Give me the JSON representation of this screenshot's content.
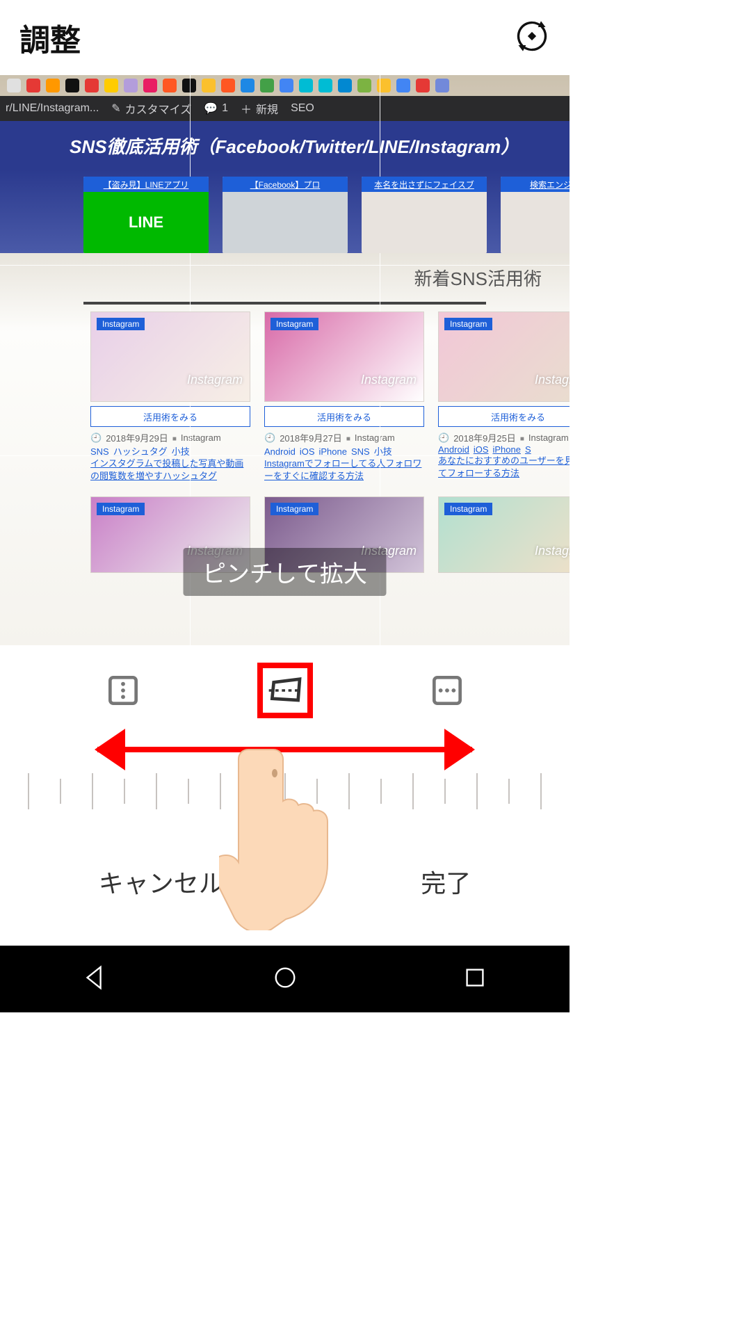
{
  "header": {
    "title": "調整"
  },
  "wp_bar": {
    "path": "r/LINE/Instagram...",
    "customize": "カスタマイズ",
    "comment_count": "1",
    "new": "新規",
    "seo": "SEO"
  },
  "banner": {
    "title": "SNS徹底活用術（Facebook/Twitter/LINE/Instagram）"
  },
  "hero": [
    {
      "top": "【盗み見】LINEアプリ",
      "body": "LINE"
    },
    {
      "top": "【Facebook】プロ",
      "body": ""
    },
    {
      "top": "本名を出さずにフェイスブ",
      "body": ""
    },
    {
      "top": "検索エンジンでフ",
      "body": ""
    }
  ],
  "section_head": "新着SNS活用術",
  "card_tag": "Instagram",
  "see_button": "活用術をみる",
  "ig_word": "Instagram",
  "articles": [
    {
      "date": "2018年9月29日",
      "cat": "Instagram",
      "tags": [
        "SNS",
        "ハッシュタグ",
        "小技"
      ],
      "desc": "インスタグラムで投稿した写真や動画の閲覧数を増やすハッシュタグ"
    },
    {
      "date": "2018年9月27日",
      "cat": "Instagram",
      "tags": [
        "Android",
        "iOS",
        "iPhone",
        "SNS",
        "小技"
      ],
      "desc": "Instagramでフォローしてる人フォロワーをすぐに確認する方法"
    },
    {
      "date": "2018年9月25日",
      "cat": "Instagram",
      "tags": [
        "Android",
        "iOS",
        "iPhone",
        "S"
      ],
      "desc": "あなたにおすすめのユーザーを見つけてフォローする方法"
    }
  ],
  "toast": "ピンチして拡大",
  "actions": {
    "cancel": "キャンセル",
    "done": "完了"
  },
  "colors": {
    "bookmark": [
      "#e0e0e0",
      "#e53935",
      "#ff9800",
      "#111",
      "#e53935",
      "#ffcc00",
      "#b39ddb",
      "#e91e63",
      "#ff5722",
      "#111",
      "#fbc02d",
      "#ff5722",
      "#1e88e5",
      "#43a047",
      "#4285f4",
      "#00bcd4",
      "#00bcd4",
      "#0288d1",
      "#7cb342",
      "#fbc02d",
      "#4285f4",
      "#e53935",
      "#7289da"
    ]
  }
}
